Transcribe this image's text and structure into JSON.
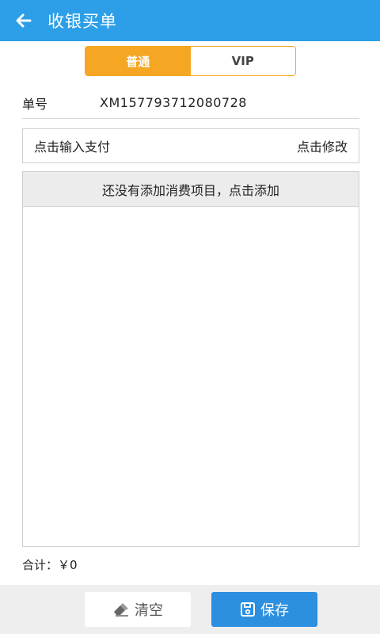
{
  "appbar": {
    "title": "收银买单",
    "back_icon": "arrow-left-icon"
  },
  "member_type_tabs": [
    {
      "label": "普通",
      "active": true
    },
    {
      "label": "VIP",
      "active": false
    }
  ],
  "order": {
    "label": "单号",
    "value": "XM157793712080728"
  },
  "payment": {
    "prompt": "点击输入支付",
    "edit_label": "点击修改"
  },
  "items": {
    "empty_hint": "还没有添加消费项目，点击添加",
    "rows": []
  },
  "total": {
    "label": "合计：",
    "value": "￥0"
  },
  "actions": {
    "clear_label": "清空",
    "clear_icon": "eraser-icon",
    "save_label": "保存",
    "save_icon": "save-icon"
  },
  "colors": {
    "primary": "#2c9fe8",
    "accent": "#f5a623",
    "save_button": "#2c8fe0"
  }
}
